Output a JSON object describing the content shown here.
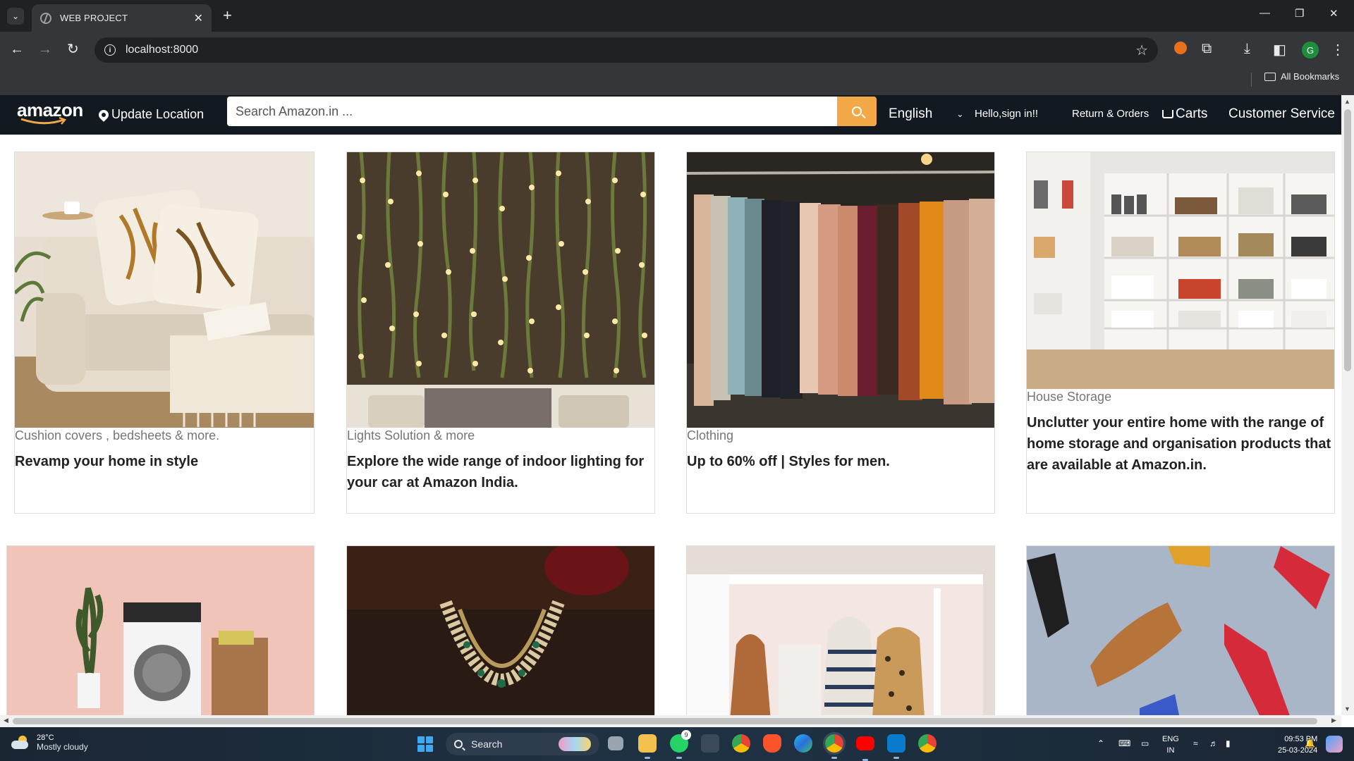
{
  "browser": {
    "tab_title": "WEB PROJECT",
    "url": "localhost:8000",
    "bookmarks_label": "All Bookmarks",
    "profile_initial": "G"
  },
  "nav": {
    "location": "Update Location",
    "search_placeholder": "Search Amazon.in ...",
    "language": "English",
    "signin": "Hello,sign in!!",
    "returns": "Return & Orders",
    "carts": "Carts",
    "customer_service": "Customer Service"
  },
  "cards": [
    {
      "category": "Cushion covers , bedsheets & more.",
      "description": "Revamp your home in style",
      "image": "sofa-cushions-photo"
    },
    {
      "category": "Lights Solution & more",
      "description": "Explore the wide range of indoor lighting for your car at Amazon India.",
      "image": "fairy-lights-wall-photo"
    },
    {
      "category": "Clothing",
      "description": "Up to 60% off | Styles for men.",
      "image": "clothes-rack-photo"
    },
    {
      "category": "House Storage",
      "description": "Unclutter your entire home with the range of home storage and organisation products that are available at Amazon.in.",
      "image": "pantry-shelves-photo"
    },
    {
      "category": "",
      "description": "",
      "image": "washing-machine-photo"
    },
    {
      "category": "",
      "description": "",
      "image": "necklace-jewellery-photo"
    },
    {
      "category": "",
      "description": "",
      "image": "handbags-shelf-photo"
    },
    {
      "category": "",
      "description": "",
      "image": "flying-shoes-photo"
    }
  ],
  "taskbar": {
    "temperature": "28°C",
    "weather": "Mostly cloudy",
    "search_label": "Search",
    "lang_line1": "ENG",
    "lang_line2": "IN",
    "time": "09:53 PM",
    "date": "25-03-2024",
    "whatsapp_badge": "9"
  }
}
